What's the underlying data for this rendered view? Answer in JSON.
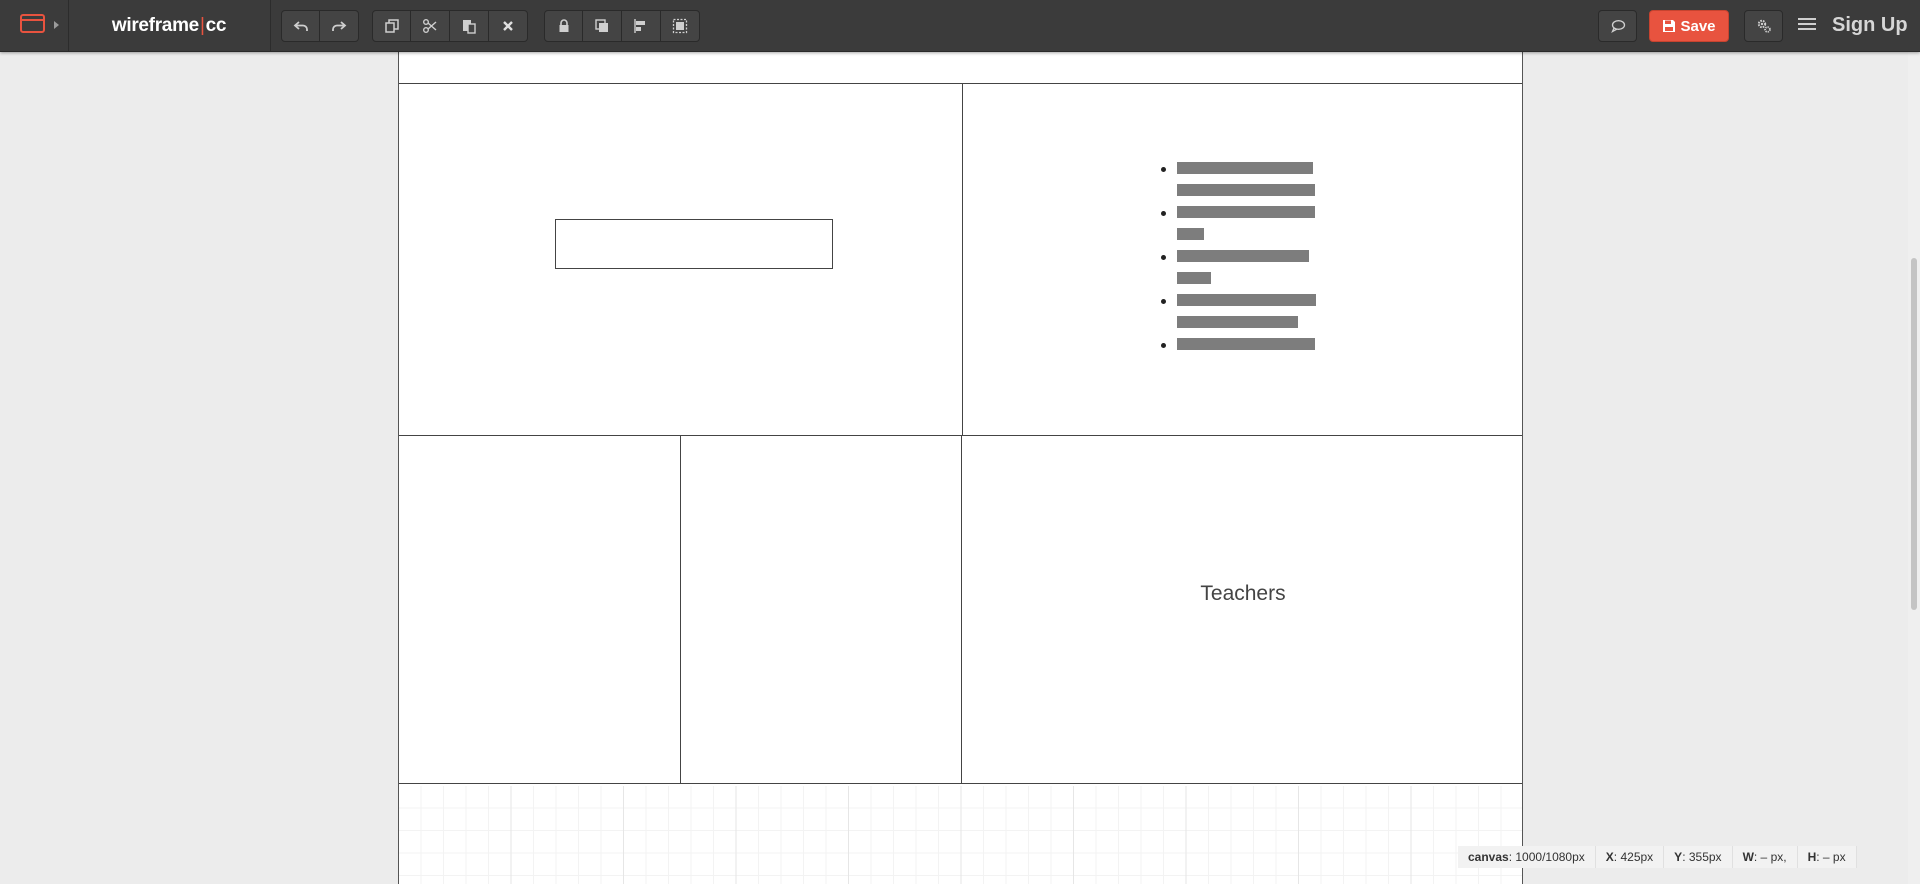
{
  "app": {
    "logo_left": "wireframe",
    "logo_sep": "|",
    "logo_right": "cc"
  },
  "toolbar": {
    "groups": [
      [
        {
          "icon": "undo-icon"
        },
        {
          "icon": "redo-icon"
        }
      ],
      [
        {
          "icon": "duplicate-icon"
        },
        {
          "icon": "cut-icon"
        },
        {
          "icon": "paste-icon"
        },
        {
          "icon": "delete-icon"
        }
      ],
      [
        {
          "icon": "lock-icon"
        },
        {
          "icon": "bring-front-icon"
        },
        {
          "icon": "align-icon"
        },
        {
          "icon": "group-icon"
        }
      ]
    ],
    "save_label": "Save",
    "signup_label": "Sign Up",
    "accent_color": "#e8533f"
  },
  "canvas": {
    "text_label": "Teachers",
    "list_item_count": 5
  },
  "status": {
    "canvas_label": "canvas",
    "canvas_value": ": 1000/1080px",
    "x_label": "X",
    "x_value": ": 425px",
    "y_label": "Y",
    "y_value": ": 355px",
    "w_label": "W",
    "w_value": ": – px,",
    "h_label": "H",
    "h_value": ": – px"
  }
}
